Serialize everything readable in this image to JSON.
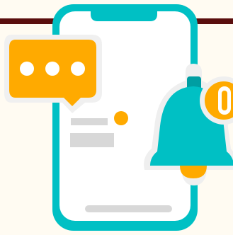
{
  "illustration": {
    "subject": "phone-notification",
    "colors": {
      "background": "#fffbf2",
      "strip": "#5a0e0e",
      "phone_frame": "#00c0c4",
      "phone_screen": "#ffffff",
      "halo": "#efefef",
      "placeholder": "#d8d8d8",
      "accent": "#ffaa00",
      "bell": "#00c0c4",
      "bell_dark": "#009ea2"
    },
    "icons": {
      "phone": "smartphone-icon",
      "chat": "chat-bubble-icon",
      "bell": "bell-icon",
      "badge": "notification-badge-icon"
    },
    "chat_dot_count": 3,
    "text_placeholder_lines": 2
  }
}
